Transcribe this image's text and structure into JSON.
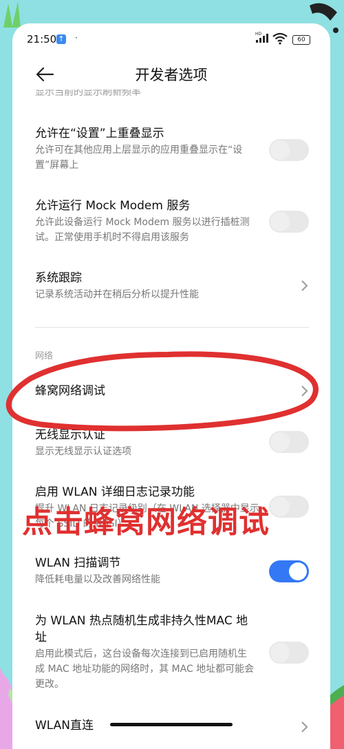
{
  "status_bar": {
    "time": "21:50",
    "upload_glyph": "↑",
    "dot": "·",
    "battery": "60"
  },
  "header": {
    "title": "开发者选项"
  },
  "partial_top": "显示当前的显示刷新频率",
  "items": [
    {
      "title": "允许在“设置”上重叠显示",
      "subtitle": "允许可在其他应用上层显示的应用重叠显示在“设置”屏幕上",
      "control": "toggle",
      "on": false
    },
    {
      "title": "允许运行 Mock Modem 服务",
      "subtitle": "允许此设备运行 Mock Modem 服务以进行插桩测试。正常使用手机时不得启用该服务",
      "control": "toggle",
      "on": false
    },
    {
      "title": "系统跟踪",
      "subtitle": "记录系统活动并在稍后分析以提升性能",
      "control": "chevron"
    },
    {
      "title": "蜂窝网络调试",
      "control": "chevron"
    },
    {
      "title": "无线显示认证",
      "subtitle": "显示无线显示认证选项",
      "control": "toggle",
      "on": false
    },
    {
      "title": "启用 WLAN 详细日志记录功能",
      "subtitle": "提升 WLAN 日志记录级别（在 WLAN 选择器中显示每个 SSID 的 RSSI）",
      "control": "toggle",
      "on": false
    },
    {
      "title": "WLAN 扫描调节",
      "subtitle": "降低耗电量以及改善网络性能",
      "control": "toggle",
      "on": true
    },
    {
      "title": "为 WLAN 热点随机生成非持久性MAC 地址",
      "subtitle": "启用此模式后，这台设备每次连接到已启用随机生成 MAC 地址功能的网络时，其 MAC 地址都可能会更改。",
      "control": "toggle",
      "on": false
    },
    {
      "title": "WLAN直连",
      "control": "chevron"
    }
  ],
  "section_network": "网络",
  "overlay_annotation": "点击蜂窝网络调试",
  "colors": {
    "accent": "#3478f6",
    "annotation": "#e03030",
    "background": "#8fe0e2"
  }
}
